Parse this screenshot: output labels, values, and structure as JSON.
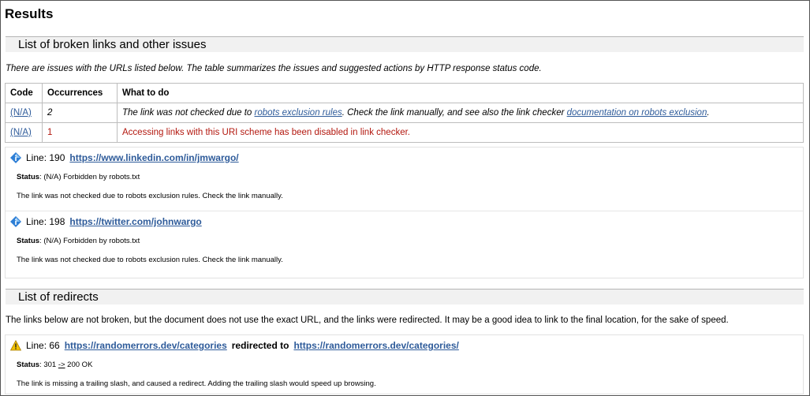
{
  "page": {
    "title": "Results"
  },
  "broken_section": {
    "heading": "List of broken links and other issues",
    "intro": "There are issues with the URLs listed below. The table summarizes the issues and suggested actions by HTTP response status code.",
    "table": {
      "headers": [
        "Code",
        "Occurrences",
        "What to do"
      ],
      "rows": [
        {
          "code": "(N/A)",
          "occurrences": "2",
          "todo_before": "The link was not checked due to ",
          "todo_link1": "robots exclusion rules",
          "todo_middle": ". Check the link manually, and see also the link checker ",
          "todo_link2": "documentation on robots exclusion",
          "todo_after": "."
        },
        {
          "code": "(N/A)",
          "occurrences": "1",
          "todo": "Accessing links with this URI scheme has been disabled in link checker."
        }
      ]
    },
    "entries": [
      {
        "line_label": "Line: 190",
        "url": "https://www.linkedin.com/in/jmwargo/",
        "status_label": "Status",
        "status_value": ": (N/A) Forbidden by robots.txt",
        "message": "The link was not checked due to robots exclusion rules. Check the link manually.",
        "icon": "info-diamond-icon"
      },
      {
        "line_label": "Line: 198",
        "url": "https://twitter.com/johnwargo",
        "status_label": "Status",
        "status_value": ": (N/A) Forbidden by robots.txt",
        "message": "The link was not checked due to robots exclusion rules. Check the link manually.",
        "icon": "info-diamond-icon"
      }
    ]
  },
  "redirect_section": {
    "heading": "List of redirects",
    "intro": "The links below are not broken, but the document does not use the exact URL, and the links were redirected. It may be a good idea to link to the final location, for the sake of speed.",
    "entries": [
      {
        "line_label": "Line: 66",
        "url_from": "https://randomerrors.dev/categories",
        "redirected_to": "redirected to",
        "url_to": "https://randomerrors.dev/categories/",
        "status_label": "Status",
        "status_code": ": 301 ",
        "status_arrow": "->",
        "status_rest": " 200 OK",
        "message": "The link is missing a trailing slash, and caused a redirect. Adding the trailing slash would speed up browsing.",
        "icon": "warning-icon"
      }
    ]
  },
  "colors": {
    "link": "#2e5b9a",
    "error_text": "#b3180f",
    "section_bg": "#f1f1f1",
    "info_icon": "#2e7fd6",
    "warning_icon": "#f2c200"
  }
}
